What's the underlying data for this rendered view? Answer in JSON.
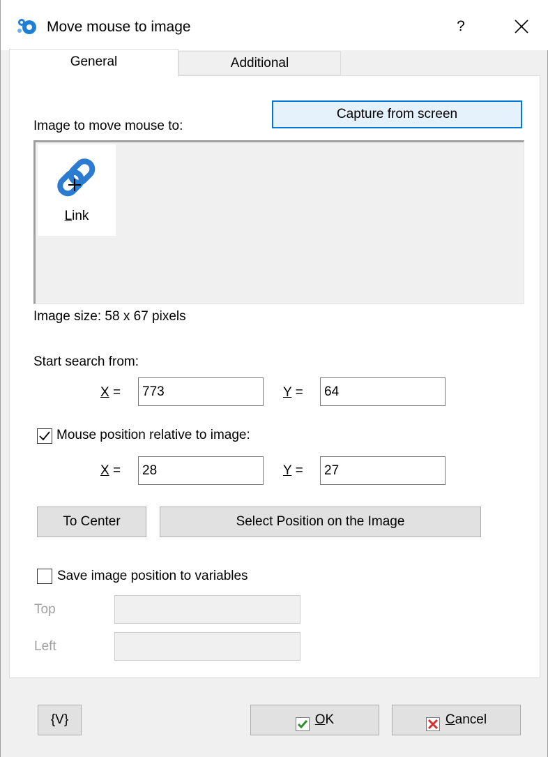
{
  "window": {
    "title": "Move mouse to image",
    "help_label": "?"
  },
  "tabs": [
    {
      "label": "General",
      "active": true
    },
    {
      "label": "Additional",
      "active": false
    }
  ],
  "general": {
    "image_label": "Image to move mouse to:",
    "capture_button": "Capture from screen",
    "captured_image": {
      "icon": "link-icon",
      "caption": "Link",
      "caption_rest": "ink",
      "caption_mnemonic": "L"
    },
    "image_size_text": "Image size: 58 x 67 pixels",
    "start_search_label": "Start search from:",
    "start_x_label": "X",
    "start_y_label": "Y",
    "equals": "=",
    "start_x_value": "773",
    "start_y_value": "64",
    "relative_checkbox": {
      "checked": true,
      "label": "Mouse position relative to image:"
    },
    "rel_x_value": "28",
    "rel_y_value": "27",
    "to_center_button": "To Center",
    "select_position_button": "Select Position on the Image",
    "save_checkbox": {
      "checked": false,
      "label": "Save image position to variables"
    },
    "top_label": "Top",
    "top_value": "",
    "left_label": "Left",
    "left_value": ""
  },
  "footer": {
    "variables_button": "{V}",
    "ok_button": "OK",
    "ok_mnemonic": "O",
    "ok_rest": "K",
    "cancel_button": "Cancel",
    "cancel_mnemonic": "C",
    "cancel_rest": "ancel"
  },
  "colors": {
    "accent": "#0078d7",
    "ok_check": "#2e8b2e",
    "cancel_x": "#d32f2f",
    "link_icon": "#2b7bd0"
  }
}
